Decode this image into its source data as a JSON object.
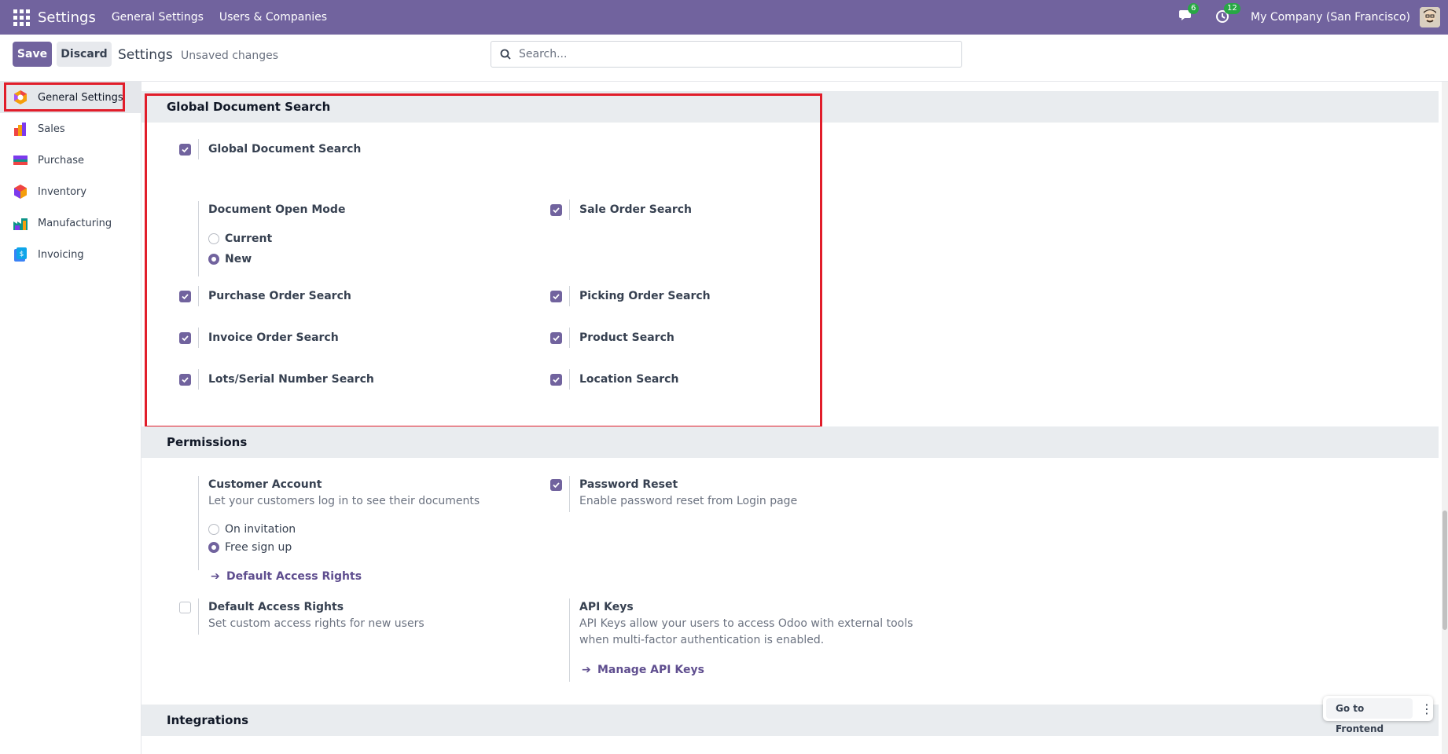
{
  "navbar": {
    "brand": "Settings",
    "menus": [
      "General Settings",
      "Users & Companies"
    ],
    "messages_badge": "6",
    "activities_badge": "12",
    "company": "My Company (San Francisco)"
  },
  "control_panel": {
    "save_label": "Save",
    "discard_label": "Discard",
    "title": "Settings",
    "unsaved": "Unsaved changes",
    "search_placeholder": "Search..."
  },
  "sidebar": {
    "items": [
      {
        "label": "General Settings",
        "icon": "general-settings-icon",
        "active": true
      },
      {
        "label": "Sales",
        "icon": "sales-icon"
      },
      {
        "label": "Purchase",
        "icon": "purchase-icon"
      },
      {
        "label": "Inventory",
        "icon": "inventory-icon"
      },
      {
        "label": "Manufacturing",
        "icon": "manufacturing-icon"
      },
      {
        "label": "Invoicing",
        "icon": "invoicing-icon"
      }
    ]
  },
  "global_search": {
    "section_title": "Global Document Search",
    "enable_label": "Global Document Search",
    "open_mode_label": "Document Open Mode",
    "open_mode_options": [
      "Current",
      "New"
    ],
    "open_mode_selected": "New",
    "sale_order": "Sale Order Search",
    "purchase_order": "Purchase Order Search",
    "picking_order": "Picking Order Search",
    "invoice_order": "Invoice Order Search",
    "product": "Product Search",
    "lots": "Lots/Serial Number Search",
    "location": "Location Search"
  },
  "permissions": {
    "section_title": "Permissions",
    "customer_account_label": "Customer Account",
    "customer_account_desc": "Let your customers log in to see their documents",
    "customer_account_options": [
      "On invitation",
      "Free sign up"
    ],
    "customer_account_selected": "Free sign up",
    "default_access_link": "Default Access Rights",
    "password_reset_label": "Password Reset",
    "password_reset_desc": "Enable password reset from Login page",
    "default_access_label": "Default Access Rights",
    "default_access_desc": "Set custom access rights for new users",
    "api_keys_label": "API Keys",
    "api_keys_desc_1": "API Keys allow your users to access Odoo with external tools",
    "api_keys_desc_2": "when multi-factor authentication is enabled.",
    "manage_api_link": "Manage API Keys"
  },
  "integrations": {
    "section_title": "Integrations"
  },
  "frontend": {
    "label": "Go to Frontend"
  },
  "colors": {
    "brand": "#71639e",
    "highlight": "#e11d2a",
    "badge": "#28a745"
  }
}
